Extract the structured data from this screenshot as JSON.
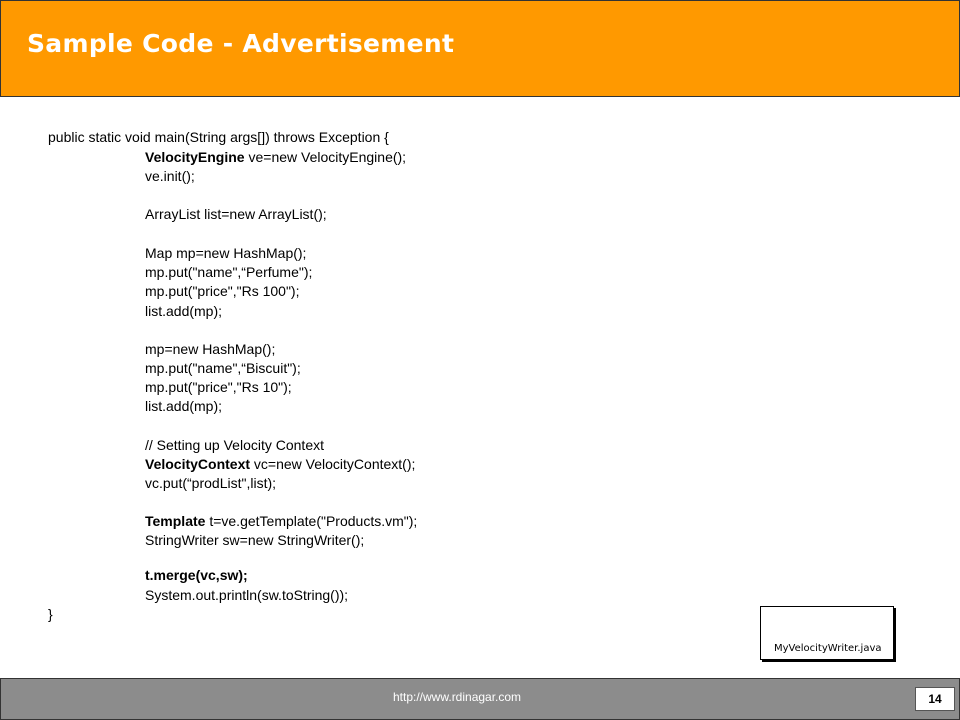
{
  "slide": {
    "title": "Sample Code - Advertisement",
    "footer_url": "http://www.rdinagar.com",
    "page_number": "14",
    "file_label": "MyVelocityWriter.java",
    "colors": {
      "header": "#ff9900",
      "footer": "#8c8c8c",
      "title_text": "#ffffff"
    }
  },
  "code": [
    {
      "text": "public static void main(String args[]) throws Exception {"
    },
    {
      "kw": "VelocityEngine",
      "text": " ve=new VelocityEngine();"
    },
    {
      "text": "ve.init();"
    },
    {
      "text": "ArrayList list=new ArrayList();"
    },
    {
      "text": "Map mp=new HashMap();"
    },
    {
      "text": "mp.put(\"name\",“Perfume\");"
    },
    {
      "text": "mp.put(\"price\",\"Rs 100\");"
    },
    {
      "text": "list.add(mp);"
    },
    {
      "text": "mp=new HashMap();"
    },
    {
      "text": "mp.put(\"name\",“Biscuit\");"
    },
    {
      "text": "mp.put(\"price\",\"Rs 10\");"
    },
    {
      "text": "list.add(mp);"
    },
    {
      "text": "// Setting up Velocity Context"
    },
    {
      "kw": "VelocityContext",
      "text": " vc=new VelocityContext();"
    },
    {
      "text": "vc.put(“prodList\",list);"
    },
    {
      "kw": "Template",
      "text": " t=ve.getTemplate(\"Products.vm\");"
    },
    {
      "text": "StringWriter sw=new StringWriter();"
    },
    {
      "kw": "t.merge(vc,sw);",
      "text": ""
    },
    {
      "text": "System.out.println(sw.toString());"
    },
    {
      "text": "}"
    }
  ]
}
